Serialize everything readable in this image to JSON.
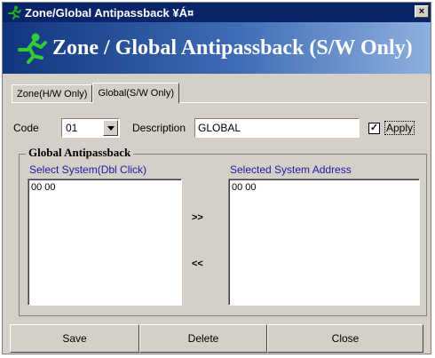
{
  "window": {
    "title": "Zone/Global Antipassback ¥Á¤",
    "close_glyph": "×"
  },
  "banner": {
    "title": "Zone / Global Antipassback (S/W Only)"
  },
  "tabs": [
    {
      "label": "Zone(H/W Only)",
      "active": false
    },
    {
      "label": "Global(S/W Only)",
      "active": true
    }
  ],
  "form": {
    "code_label": "Code",
    "code_value": "01",
    "description_label": "Description",
    "description_value": "GLOBAL",
    "apply_label": "Apply",
    "apply_checked": true
  },
  "group": {
    "title": "Global Antipassback",
    "select_system_title": "Select System(Dbl Click)",
    "selected_address_title": "Selected System Address",
    "select_system_items": [
      "00 00"
    ],
    "selected_address_items": [
      "00 00"
    ],
    "add_label": ">>",
    "remove_label": "<<"
  },
  "buttons": {
    "save": "Save",
    "delete": "Delete",
    "close": "Close"
  },
  "colors": {
    "title_bar": "#0a246a",
    "banner_start": "#10357e",
    "banner_end": "#8fb0df",
    "list_title": "#1a1aa6",
    "face": "#d4d0c8",
    "runner_icon": "#22b022"
  }
}
